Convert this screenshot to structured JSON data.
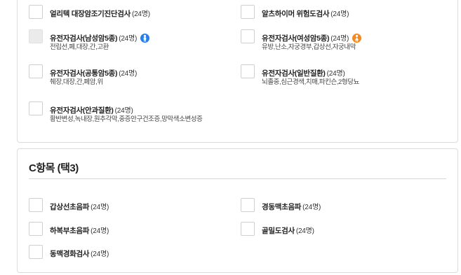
{
  "section_b": {
    "items": [
      {
        "name": "얼리텍 대장암조기진단검사",
        "count": "(24명)",
        "sub": ""
      },
      {
        "name": "알츠하이머 위험도검사",
        "count": "(24명)",
        "sub": ""
      },
      {
        "name": "유전자검사(남성암5종)",
        "count": "(24명)",
        "sub": "전립선,폐,대장,간,고환",
        "gender_icon": "male-icon"
      },
      {
        "name": "유전자검사(여성암5종)",
        "count": "(24명)",
        "sub": "유방,난소,자궁경부,갑상선,자궁내막",
        "gender_icon": "female-icon"
      },
      {
        "name": "유전자검사(공통암5종)",
        "count": "(24명)",
        "sub": "췌장,대장,간,폐암,위"
      },
      {
        "name": "유전자검사(일반질환)",
        "count": "(24명)",
        "sub": "뇌졸중,심근경색,치매,파킨슨,2형당뇨"
      },
      {
        "name": "유전자검사(안과질환)",
        "count": "(24명)",
        "sub": "황반변성,녹내장,원추각막,중증안구건조증,망막색소변성증"
      }
    ]
  },
  "section_c": {
    "title": "C항목 (택3)",
    "items": [
      {
        "name": "갑상선초음파",
        "count": "(24명)"
      },
      {
        "name": "경동맥초음파",
        "count": "(24명)"
      },
      {
        "name": "하복부초음파",
        "count": "(24명)"
      },
      {
        "name": "골밀도검사",
        "count": "(24명)"
      },
      {
        "name": "동맥경화검사",
        "count": "(24명)"
      }
    ]
  },
  "colors": {
    "male_icon": "#2b7de9",
    "female_icon": "#f08a24",
    "checkbox_border": "#cfcfcf",
    "disabled_fill": "#ebebeb"
  }
}
